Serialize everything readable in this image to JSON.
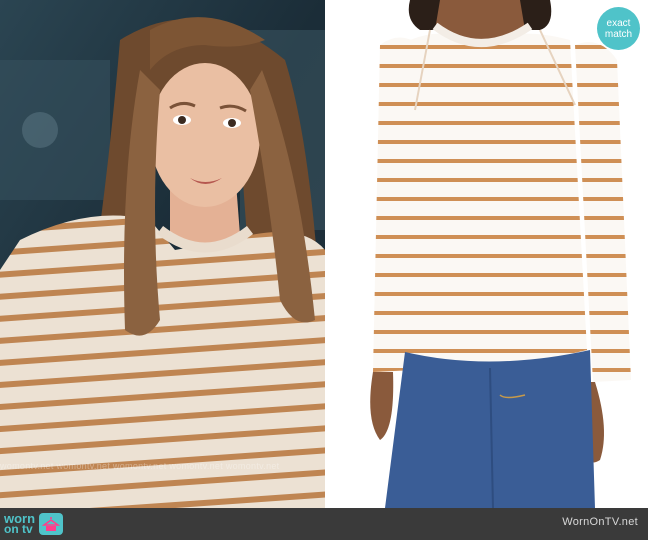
{
  "watermark": {
    "text": "womontv.net womontv.net womontv.net womontv.net womontv.net"
  },
  "badge": {
    "line1": "exact",
    "line2": "match"
  },
  "footer": {
    "logo_line1": "worn",
    "logo_line2": "on tv",
    "site": "WornOnTV.net"
  },
  "colors": {
    "stripe": "#c8894f",
    "shirt_base": "#efe4d8",
    "badge": "#4fc3c9",
    "footer_bg": "#3a3a3a"
  }
}
